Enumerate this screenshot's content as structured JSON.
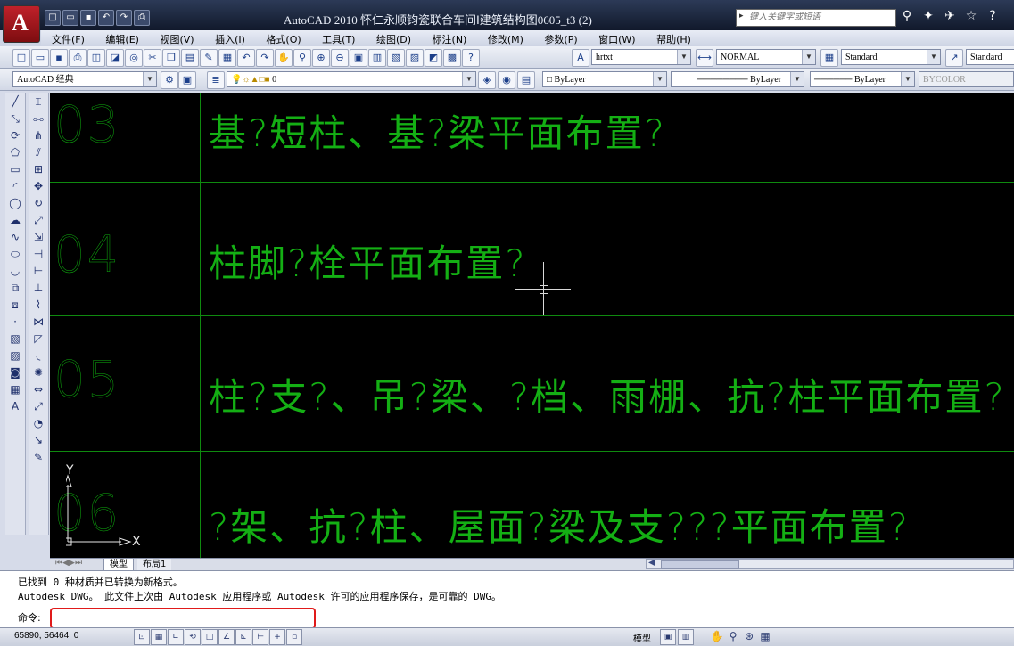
{
  "window": {
    "title": "AutoCAD 2010   怀仁永顺钧瓷联合车间Ⅰ建筑结构图0605_t3 (2)",
    "search_placeholder": "键入关键字或短语"
  },
  "menu": [
    "文件(F)",
    "编辑(E)",
    "视图(V)",
    "插入(I)",
    "格式(O)",
    "工具(T)",
    "绘图(D)",
    "标注(N)",
    "修改(M)",
    "参数(P)",
    "窗口(W)",
    "帮助(H)"
  ],
  "toolbar1": {
    "text_style": "hrtxt",
    "dim_style": "NORMAL",
    "table_style": "Standard",
    "multileader_style": "Standard"
  },
  "toolbar2": {
    "workspace": "AutoCAD 经典",
    "layer": "0",
    "color": "ByLayer",
    "linetype": "ByLayer",
    "lineweight": "ByLayer",
    "plotstyle": "BYCOLOR"
  },
  "drawing": {
    "rows": [
      {
        "num": "03",
        "text": "基?短柱、基?梁平面布置?"
      },
      {
        "num": "04",
        "text": "柱脚?栓平面布置?"
      },
      {
        "num": "05",
        "text": "柱?支?、吊?梁、?档、雨棚、抗?柱平面布置?"
      },
      {
        "num": "06",
        "text": "?架、抗?柱、屋面?梁及支???平面布置?"
      }
    ],
    "ucs_y": "Y",
    "ucs_x": "X"
  },
  "tabs": {
    "model": "模型",
    "layout1": "布局1"
  },
  "command": {
    "line1": "已找到 0 种材质并已转换为新格式。",
    "line2": "Autodesk DWG。  此文件上次由 Autodesk 应用程序或 Autodesk 许可的应用程序保存，是可靠的 DWG。",
    "prompt": "命令:",
    "value": ""
  },
  "status": {
    "coords": "65890, 56464, 0",
    "model_label": "模型"
  },
  "colors": {
    "canvas_bg": "#000000",
    "drawing_text": "#17c317",
    "grid_line": "#0f8a0f",
    "highlight": "#e01a1a"
  }
}
